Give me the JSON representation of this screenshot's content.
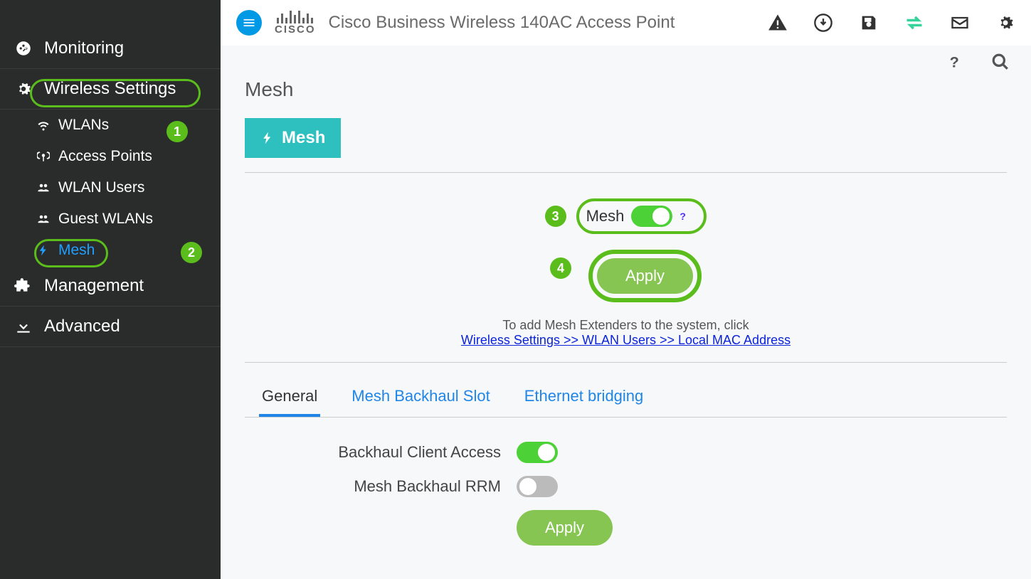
{
  "header": {
    "product_title": "Cisco Business Wireless 140AC Access Point",
    "logo_text": "CISCO"
  },
  "sidebar": {
    "monitoring": "Monitoring",
    "wireless_settings": "Wireless Settings",
    "wlans": "WLANs",
    "access_points": "Access Points",
    "wlan_users": "WLAN Users",
    "guest_wlans": "Guest WLANs",
    "mesh": "Mesh",
    "management": "Management",
    "advanced": "Advanced",
    "badge1": "1",
    "badge2": "2"
  },
  "page": {
    "title": "Mesh",
    "tab_button": "Mesh",
    "toggle_label": "Mesh",
    "badge3": "3",
    "badge4": "4",
    "apply_top": "Apply",
    "hint_text": "To add Mesh Extenders to the system, click",
    "hint_link": "Wireless Settings >> WLAN Users >> Local MAC Address",
    "tabs": {
      "general": "General",
      "backhaul": "Mesh Backhaul Slot",
      "ethernet": "Ethernet bridging"
    },
    "row1": "Backhaul Client Access",
    "row2": "Mesh Backhaul RRM",
    "apply_bottom": "Apply"
  }
}
